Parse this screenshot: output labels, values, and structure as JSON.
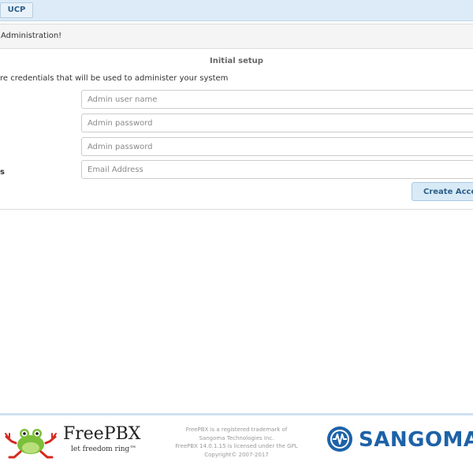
{
  "topbar": {
    "ucp_label": "UCP"
  },
  "panel": {
    "heading": "Administration!",
    "title": "Initial setup",
    "intro": "re credentials that will be used to administer your system"
  },
  "form": {
    "username": {
      "label": "",
      "placeholder": "Admin user name",
      "value": ""
    },
    "password": {
      "label": "",
      "placeholder": "Admin password",
      "value": ""
    },
    "confirm_password": {
      "label": "",
      "placeholder": "Admin password",
      "value": ""
    },
    "email": {
      "label": "s",
      "placeholder": "Email Address",
      "value": ""
    },
    "submit_label": "Create Account"
  },
  "footer": {
    "freepbx_name": "FreePBX",
    "freepbx_tagline": "let freedom ring™",
    "legal": [
      "FreePBX is a registered trademark of",
      "Sangoma Technologies Inc.",
      "FreePBX 14.0.1.15 is licensed under the GPL",
      "Copyright© 2007-2017"
    ],
    "sangoma_name": "SANGOMA"
  },
  "colors": {
    "topbar_bg": "#dcebf7",
    "accent_text": "#2c5f8a",
    "button_bg": "#d9eaf7",
    "sangoma_blue": "#1d62a8"
  }
}
